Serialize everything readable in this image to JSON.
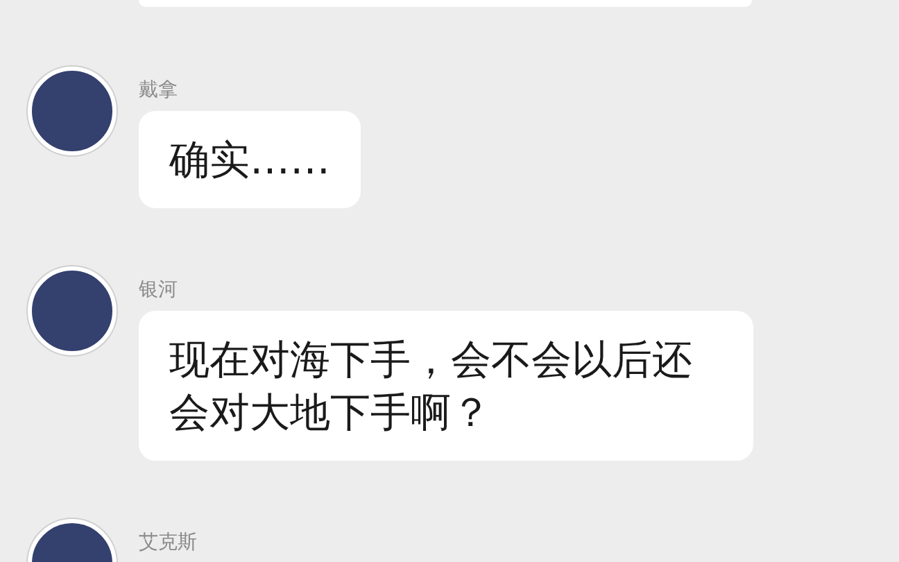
{
  "messages": [
    {
      "sender": "戴拿",
      "text": "确实……"
    },
    {
      "sender": "银河",
      "text": "现在对海下手，会不会以后还会对大地下手啊？"
    },
    {
      "sender": "艾克斯"
    }
  ]
}
